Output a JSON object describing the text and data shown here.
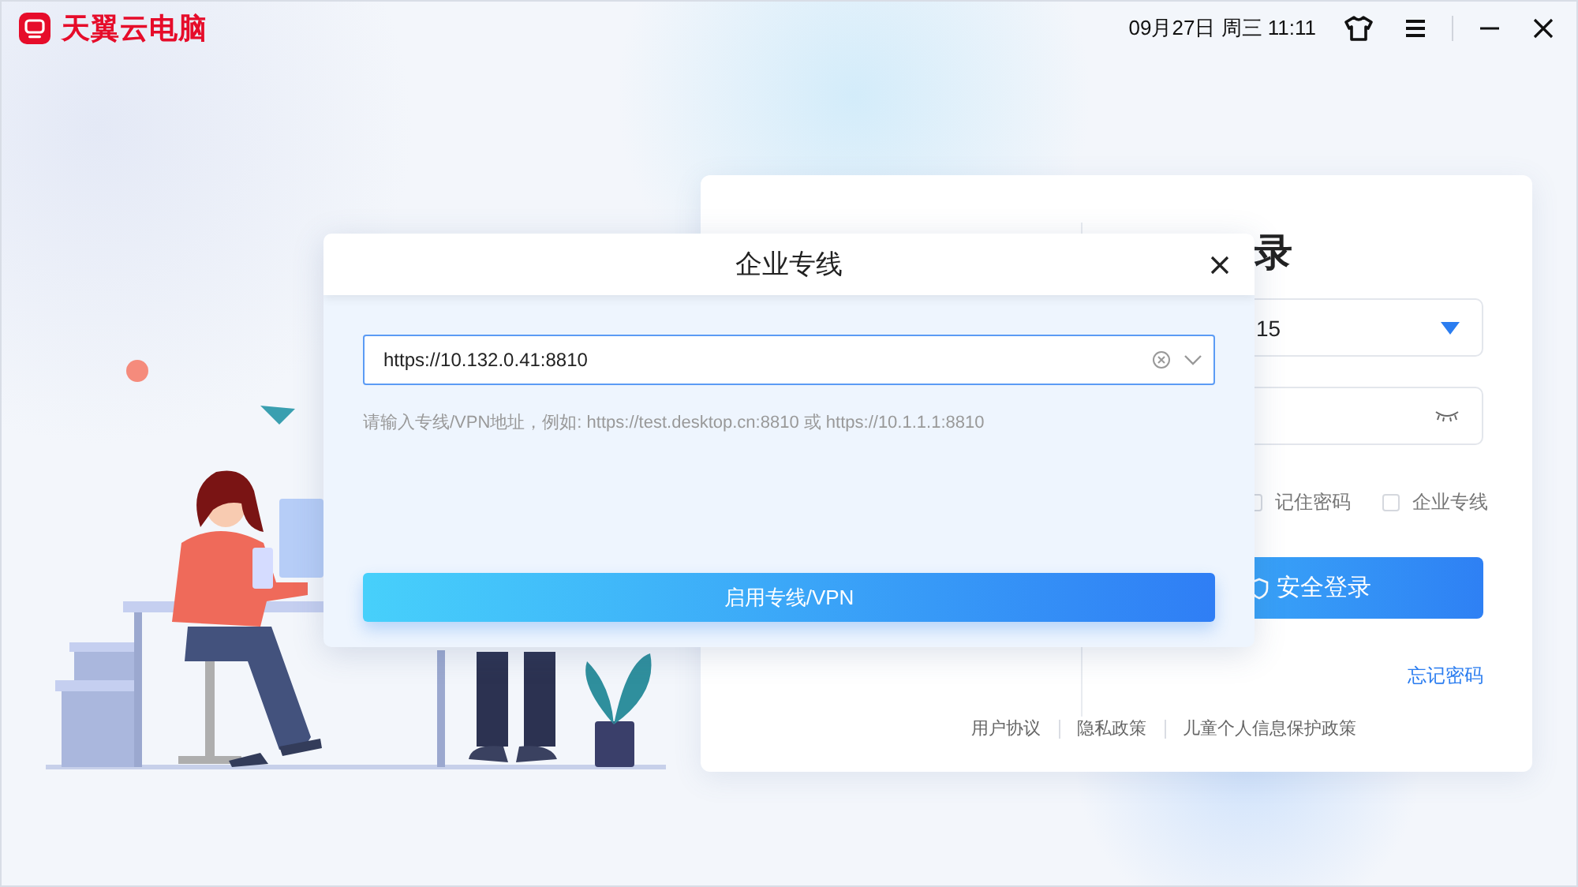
{
  "app": {
    "title": "天翼云电脑"
  },
  "title_bar": {
    "datetime": "09月27日 周三 11:11"
  },
  "login": {
    "title": "录",
    "account": "15",
    "options": [
      {
        "label": "记住密码",
        "checked": false
      },
      {
        "label": "企业专线",
        "checked": false
      }
    ],
    "submit": "安全登录",
    "forgot": "忘记密码",
    "footer_links": [
      "用户协议",
      "隐私政策",
      "儿童个人信息保护政策"
    ]
  },
  "dialog": {
    "title": "企业专线",
    "address": "https://10.132.0.41:8810",
    "hint": "请输入专线/VPN地址，例如: https://test.desktop.cn:8810 或 https://10.1.1.1:8810",
    "button": "启用专线/VPN"
  }
}
